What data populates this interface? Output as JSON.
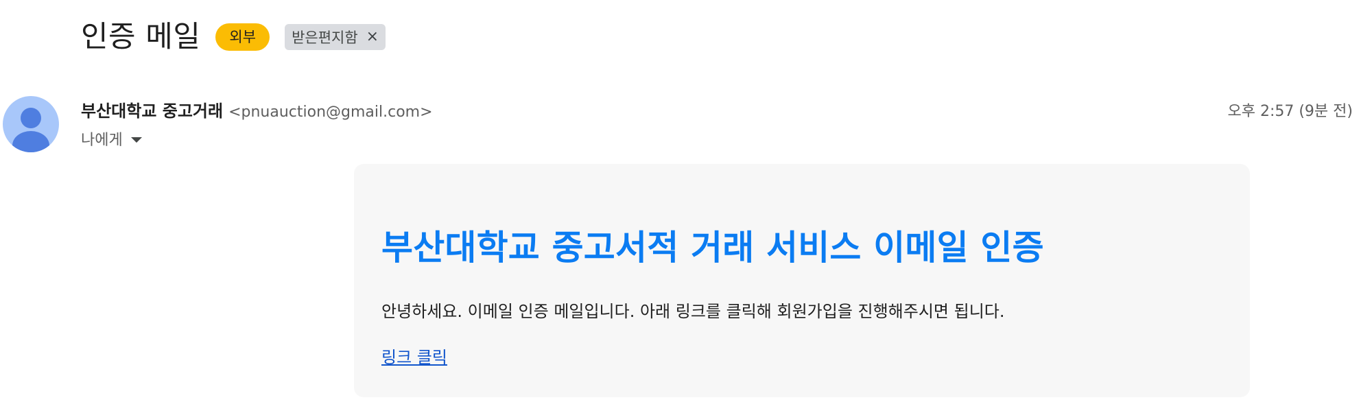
{
  "subject": {
    "title": "인증 메일",
    "external_badge": "외부",
    "label_chip": "받은편지함",
    "label_remove": "×"
  },
  "message": {
    "sender_name": "부산대학교 중고거래",
    "sender_email": "<pnuauction@gmail.com>",
    "recipient": "나에게",
    "timestamp": "오후 2:57 (9분 전)",
    "avatar_icon": "default-person-avatar"
  },
  "body": {
    "heading": "부산대학교 중고서적 거래 서비스 이메일 인증",
    "text": "안녕하세요. 이메일 인증 메일입니다. 아래 링크를 클릭해 회원가입을 진행해주시면 됩니다.",
    "link": "링크 클릭"
  },
  "colors": {
    "external_badge": "#fbbc04",
    "label_chip": "#dadce0",
    "heading": "#0b7cf2",
    "link": "#1155cc",
    "card_background": "#f7f7f7",
    "avatar_background": "#a8c7fa",
    "avatar_figure": "#4f7ee0"
  }
}
